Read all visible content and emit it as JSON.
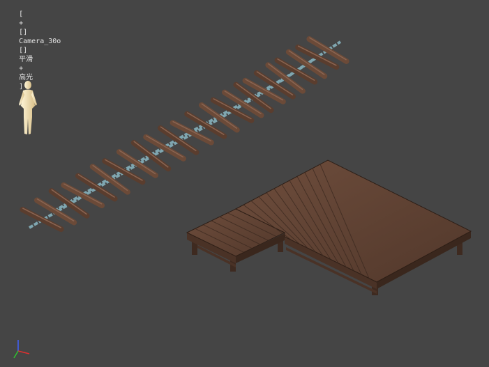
{
  "viewport": {
    "label_open": "[",
    "plus": "+",
    "bracket1": "[]",
    "camera_name": "Camera_30o",
    "bracket2": "[]",
    "shading_mode": "平滑",
    "plus2": "+",
    "highlight_mode": "高光",
    "label_close": "]",
    "background_color": "#454545"
  },
  "scene_objects": [
    {
      "name": "reference-human-figure",
      "color": "#f3e3b5"
    },
    {
      "name": "rope-plank-bridge",
      "plank_color": "#6b4a38",
      "chain_color": "#7fa6b0"
    },
    {
      "name": "wooden-deck-platform",
      "color": "#5e4032"
    }
  ],
  "axis_gizmo": {
    "x_color": "#e03030",
    "y_color": "#30c030",
    "z_color": "#4060ff"
  }
}
